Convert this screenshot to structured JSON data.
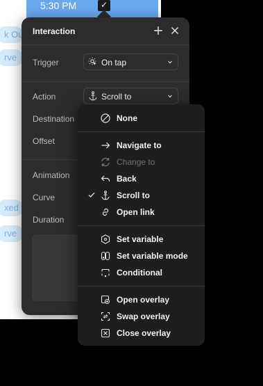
{
  "canvas": {
    "time": "5:30 PM",
    "check_glyph": "✓",
    "pills": [
      "k Out",
      "rve",
      "xed Ou",
      "rve"
    ]
  },
  "panel": {
    "title": "Interaction",
    "rows": {
      "trigger": {
        "label": "Trigger",
        "value": "On tap",
        "icon": "tap-icon"
      },
      "action": {
        "label": "Action",
        "value": "Scroll to",
        "icon": "anchor-icon"
      },
      "destination": {
        "label": "Destination"
      },
      "offset": {
        "label": "Offset"
      },
      "animation": {
        "label": "Animation"
      },
      "curve": {
        "label": "Curve"
      },
      "duration": {
        "label": "Duration"
      }
    }
  },
  "menu": {
    "selected": "Scroll to",
    "items": [
      {
        "label": "None",
        "icon": "none-circle-icon"
      },
      {
        "label": "Navigate to",
        "icon": "arrow-right-icon"
      },
      {
        "label": "Change to",
        "icon": "swap-cycle-icon",
        "disabled": true
      },
      {
        "label": "Back",
        "icon": "back-arrow-icon"
      },
      {
        "label": "Scroll to",
        "icon": "anchor-icon",
        "checked": true
      },
      {
        "label": "Open link",
        "icon": "link-icon"
      },
      {
        "label": "Set variable",
        "icon": "variable-icon"
      },
      {
        "label": "Set variable mode",
        "icon": "variable-mode-icon"
      },
      {
        "label": "Conditional",
        "icon": "conditional-icon"
      },
      {
        "label": "Open overlay",
        "icon": "open-overlay-icon"
      },
      {
        "label": "Swap overlay",
        "icon": "swap-overlay-icon"
      },
      {
        "label": "Close overlay",
        "icon": "close-overlay-icon"
      }
    ]
  },
  "colors": {
    "panel_bg": "#2c2c2c",
    "menu_bg": "#1e1e1e",
    "canvas_accent": "#6aa8ee",
    "pill_bg": "#d6ebfb",
    "disabled_text": "#6e6e6e"
  }
}
